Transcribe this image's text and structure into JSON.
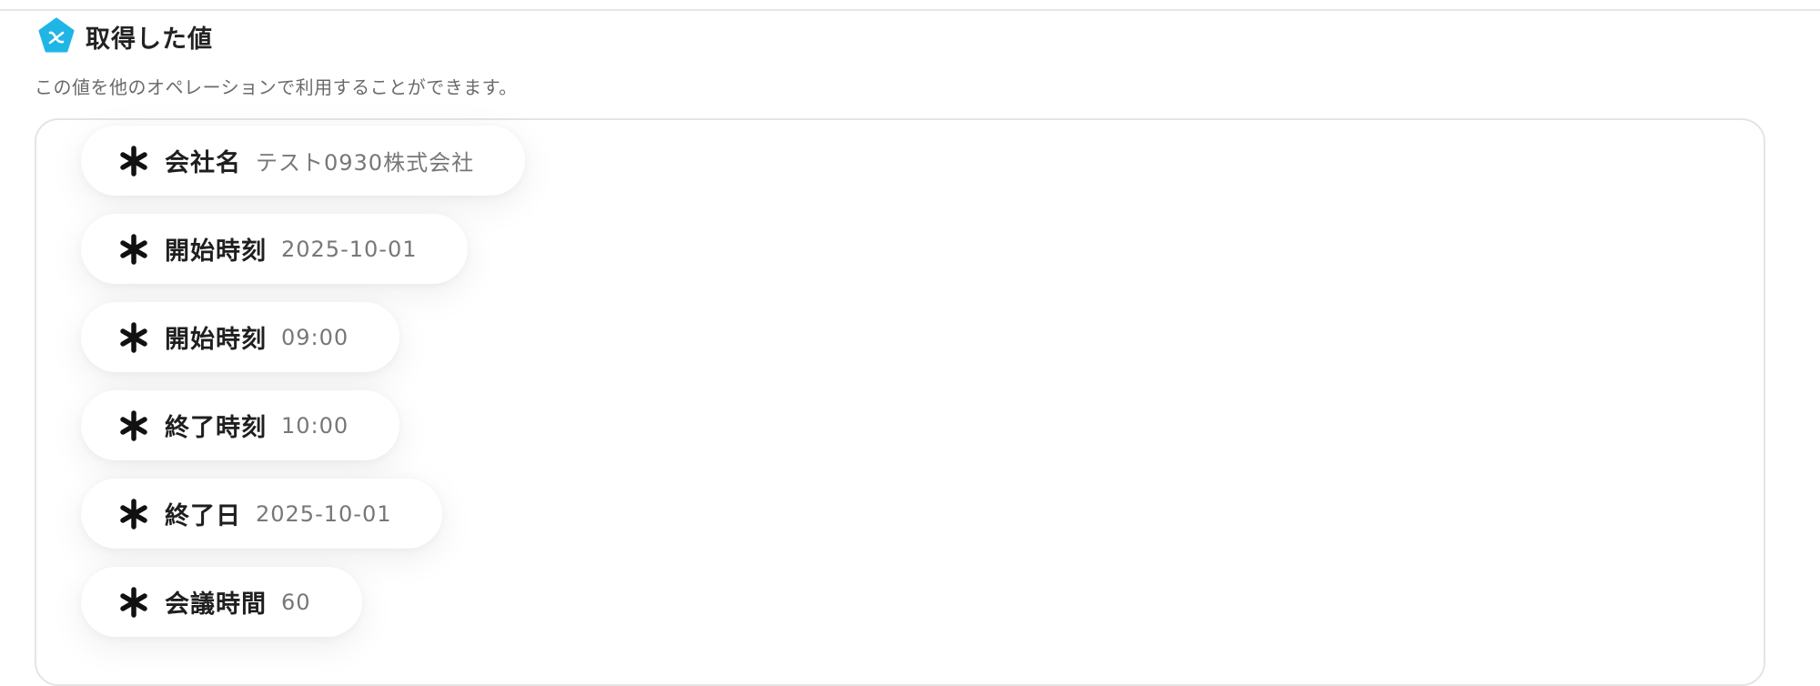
{
  "header": {
    "logo_icon": "yoom-pentagon-logo-icon",
    "title": "取得した値"
  },
  "description": "この値を他のオペレーションで利用することができます。",
  "colors": {
    "logo": "#1fb6e6",
    "asterisk": "#111111"
  },
  "values": [
    {
      "icon": "asterisk-icon",
      "label": "会社名",
      "value": "テスト0930株式会社"
    },
    {
      "icon": "asterisk-icon",
      "label": "開始時刻",
      "value": "2025-10-01"
    },
    {
      "icon": "asterisk-icon",
      "label": "開始時刻",
      "value": "09:00"
    },
    {
      "icon": "asterisk-icon",
      "label": "終了時刻",
      "value": "10:00"
    },
    {
      "icon": "asterisk-icon",
      "label": "終了日",
      "value": "2025-10-01"
    },
    {
      "icon": "asterisk-icon",
      "label": "会議時間",
      "value": "60"
    }
  ]
}
